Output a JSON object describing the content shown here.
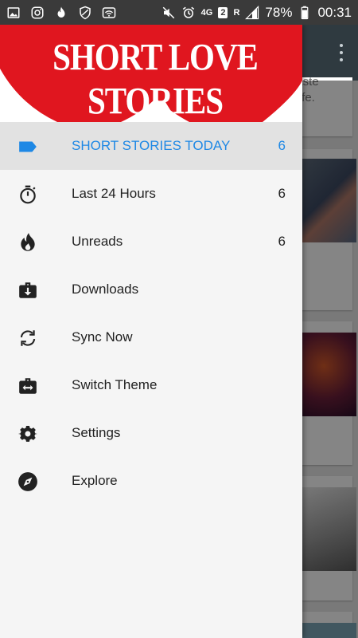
{
  "status_bar": {
    "icons_left": [
      "image-icon",
      "instagram-icon",
      "flame-icon",
      "blocked-shield-icon",
      "wifi-icon"
    ],
    "icons_right": [
      "mute-icon",
      "alarm-icon",
      "network-4g-icon",
      "sim-2-icon",
      "signal-roaming-icon",
      "signal-icon",
      "battery-icon"
    ],
    "network_label": "4G",
    "sim_label": "2",
    "roaming_label": "R",
    "battery": "78%",
    "time": "00:31"
  },
  "background": {
    "card_texts": [
      "paste",
      "n life."
    ]
  },
  "drawer": {
    "header_title": "SHORT LOVE STORIES",
    "header_color": "#e0161f",
    "accent_color": "#1e88e5",
    "items": [
      {
        "label": "SHORT STORIES TODAY",
        "count": "6",
        "icon": "label-tag-icon",
        "active": true
      },
      {
        "label": "Last 24 Hours",
        "count": "6",
        "icon": "stopwatch-icon"
      },
      {
        "label": "Unreads",
        "count": "6",
        "icon": "flame-icon"
      },
      {
        "label": "Downloads",
        "count": "",
        "icon": "download-briefcase-icon"
      },
      {
        "label": "Sync Now",
        "count": "",
        "icon": "sync-icon"
      },
      {
        "label": "Switch Theme",
        "count": "",
        "icon": "switch-theme-icon"
      },
      {
        "label": "Settings",
        "count": "",
        "icon": "gear-icon"
      },
      {
        "label": "Explore",
        "count": "",
        "icon": "compass-icon"
      }
    ]
  }
}
